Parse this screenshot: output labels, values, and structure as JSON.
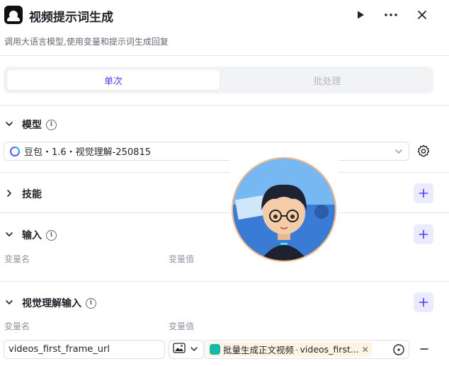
{
  "header": {
    "title": "视频提示词生成",
    "subtitle": "调用大语言模型,使用变量和提示词生成回复",
    "run_icon": "play-icon",
    "more_icon": "more-icon",
    "close_icon": "close-icon"
  },
  "mode_tabs": [
    {
      "label": "单次",
      "active": true
    },
    {
      "label": "批处理",
      "active": false
    }
  ],
  "model_section": {
    "title": "模型",
    "selected_model": "豆包・1.6・视觉理解-250815"
  },
  "skills_section": {
    "title": "技能"
  },
  "input_section": {
    "title": "输入",
    "col_name": "变量名",
    "col_value": "变量值"
  },
  "vision_section": {
    "title": "视觉理解输入",
    "col_name": "变量名",
    "col_value": "变量值",
    "row": {
      "var_name": "videos_first_frame_url",
      "ref_node": "批量生成正文视频",
      "ref_sep": "-",
      "ref_var": "videos_first..."
    }
  },
  "colors": {
    "accent": "#4e40e5",
    "accent_bg": "#ebeafe",
    "chip_bg": "#fff3e3",
    "node_icon": "#14b8a6"
  }
}
